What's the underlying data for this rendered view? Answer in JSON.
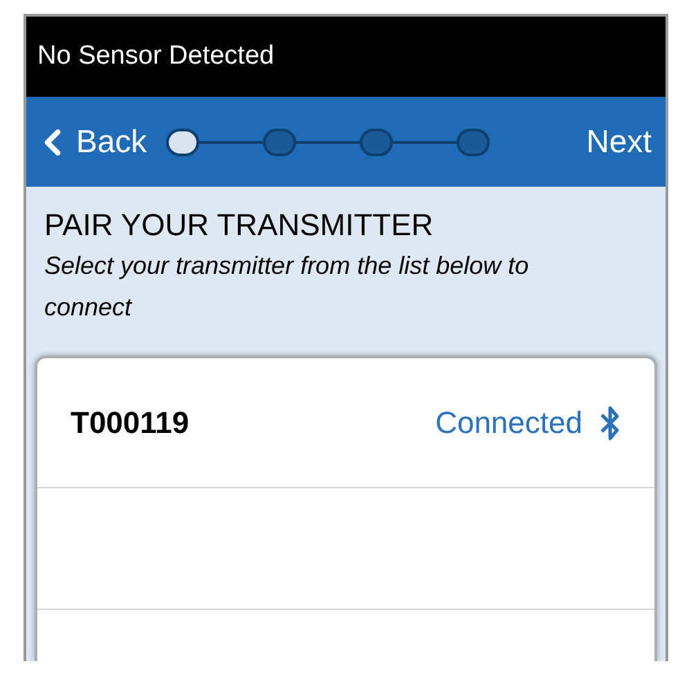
{
  "status_bar": {
    "message": "No Sensor Detected"
  },
  "nav": {
    "back": "Back",
    "next": "Next",
    "steps": [
      {
        "selected": true
      },
      {
        "selected": false
      },
      {
        "selected": false
      },
      {
        "selected": false
      }
    ]
  },
  "header": {
    "title": "PAIR YOUR TRANSMITTER",
    "subtitle": "Select your transmitter from the list below to connect"
  },
  "transmitters": [
    {
      "id": "T000119",
      "status": "Connected",
      "connected": true
    }
  ]
}
